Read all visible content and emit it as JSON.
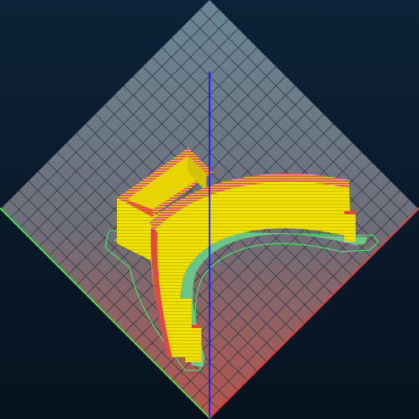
{
  "viewport": {
    "kind": "3d-printer-layer-preview",
    "background_top": "#0d2238",
    "background_bottom": "#06121f"
  },
  "colors": {
    "bed_top": "#5c7888",
    "bed_bottom": "#b06058",
    "grid_line": "#2e3a44",
    "axis_x": "#ff3030",
    "axis_y": "#30ff30",
    "axis_z": "#2020ff",
    "perimeter": "#f0e000",
    "perimeter_shadow": "#c8b800",
    "inner_wall": "#e85050",
    "skirt": "#40e860",
    "support_base": "#70d890"
  },
  "grid": {
    "divisions": 22
  },
  "icons": [
    "x-axis-line",
    "y-axis-line",
    "z-axis-line"
  ]
}
